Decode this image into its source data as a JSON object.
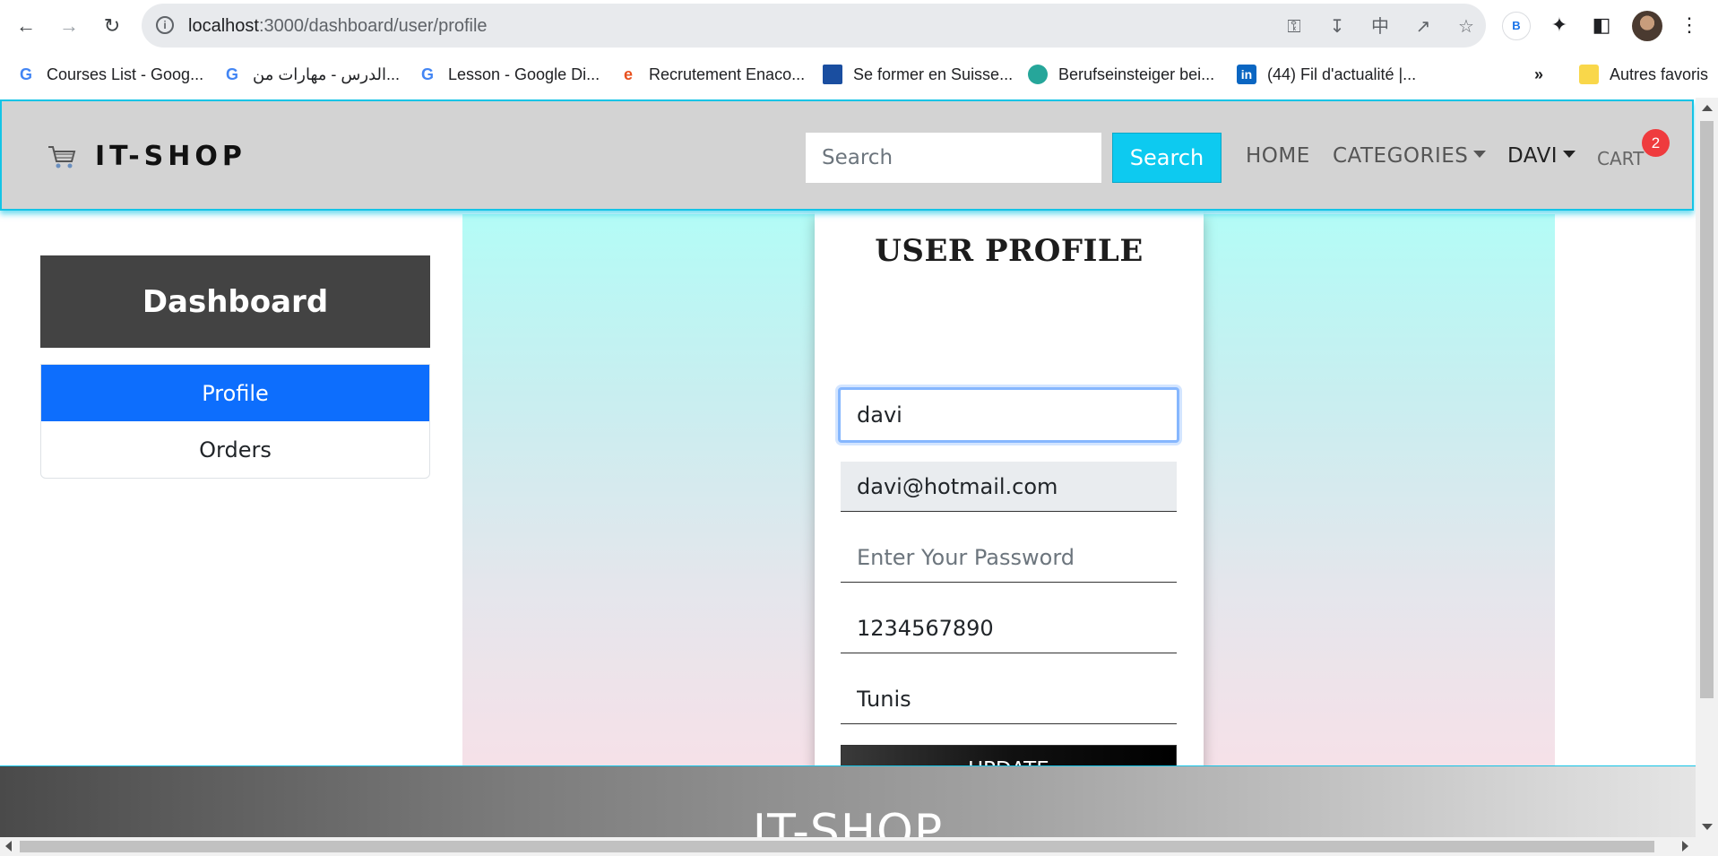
{
  "browser": {
    "url_host": "localhost",
    "url_path": ":3000/dashboard/user/profile",
    "profile_letter": "B",
    "icons": [
      "back-icon",
      "forward-icon",
      "reload-icon",
      "info-icon",
      "key-icon",
      "install-icon",
      "translate-icon",
      "share-icon",
      "star-icon",
      "extensions-icon",
      "sidepanel-icon",
      "menu-icon"
    ]
  },
  "bookmarks": [
    {
      "label": "Courses List - Goog...",
      "icon": "google-icon"
    },
    {
      "label": "الدرس - مهارات من...",
      "icon": "google-icon"
    },
    {
      "label": "Lesson - Google Di...",
      "icon": "google-icon"
    },
    {
      "label": "Recrutement Enaco...",
      "icon": "enaco-icon"
    },
    {
      "label": "Se former en Suisse...",
      "icon": "bookmark-site-icon"
    },
    {
      "label": "Berufseinsteiger bei...",
      "icon": "bookmark-site-icon"
    },
    {
      "label": "(44) Fil d'actualité |...",
      "icon": "linkedin-icon"
    }
  ],
  "bookmarks_more": "»",
  "bookmarks_other": "Autres favoris",
  "header": {
    "brand": "IT-SHOP",
    "search_placeholder": "Search",
    "search_button": "Search",
    "nav_home": "HOME",
    "nav_categories": "CATEGORIES",
    "nav_user": "DAVI",
    "nav_cart": "CART",
    "cart_count": "2"
  },
  "sidebar": {
    "title": "Dashboard",
    "items": [
      {
        "label": "Profile",
        "active": true
      },
      {
        "label": "Orders",
        "active": false
      }
    ]
  },
  "profile": {
    "title": "USER PROFILE",
    "name_value": "davi",
    "email_value": "davi@hotmail.com",
    "password_placeholder": "Enter Your Password",
    "phone_value": "1234567890",
    "address_value": "Tunis",
    "update_button": "UPDATE"
  },
  "footer": {
    "title": "IT-SHOP"
  },
  "colors": {
    "header_border": "#14c4e6",
    "active_item": "#0d6efd",
    "search_button": "#0dcaf0",
    "cart_badge": "#ef3b3e"
  }
}
